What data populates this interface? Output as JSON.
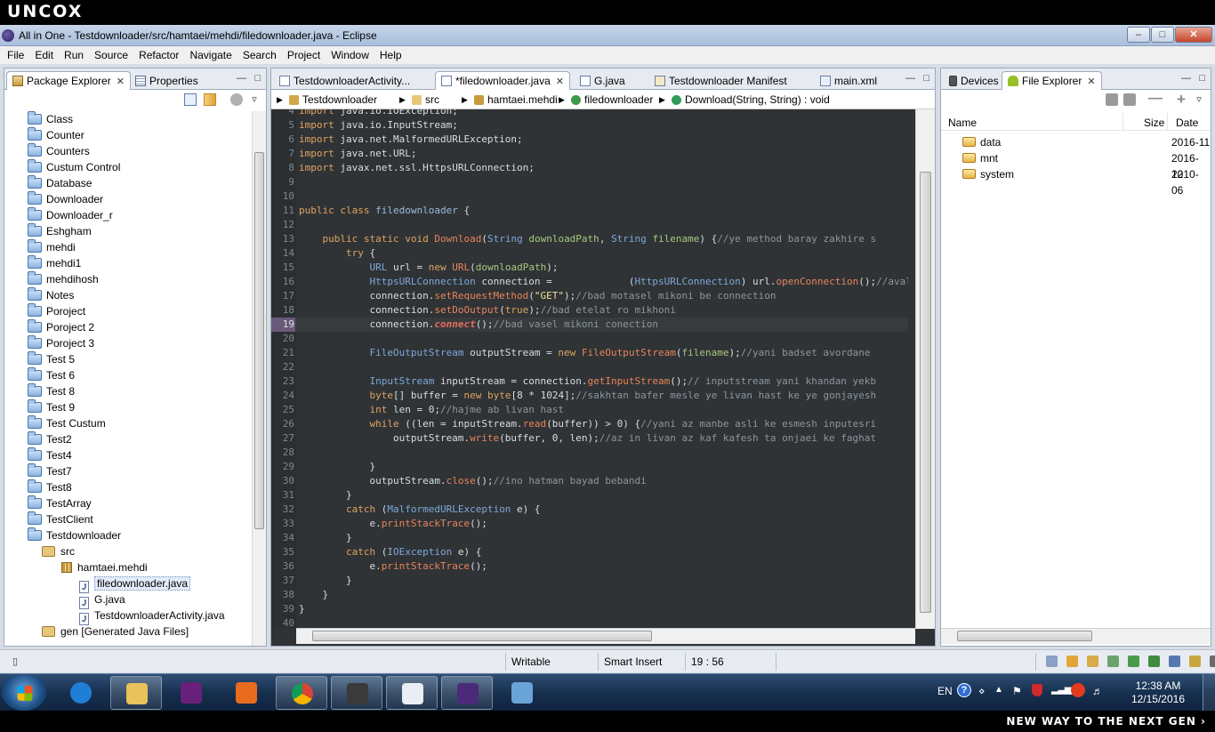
{
  "brand": "uncox",
  "slogan": "NEW WAY TO THE NEXT GEN ›",
  "window": {
    "title": "All in One - Testdownloader/src/hamtaei/mehdi/filedownloader.java - Eclipse",
    "minimize": "–",
    "maximize": "□",
    "close": "✕"
  },
  "menu": [
    "File",
    "Edit",
    "Run",
    "Source",
    "Refactor",
    "Navigate",
    "Search",
    "Project",
    "Window",
    "Help"
  ],
  "left_panel": {
    "tabs": [
      {
        "label": "Package Explorer",
        "close": "✕",
        "icon": "package-explorer-icon"
      },
      {
        "label": "Properties",
        "icon": "properties-icon"
      }
    ],
    "tree": [
      {
        "label": "Class",
        "kind": "project",
        "level": 0
      },
      {
        "label": "Counter",
        "kind": "project",
        "level": 0
      },
      {
        "label": "Counters",
        "kind": "project",
        "level": 0
      },
      {
        "label": "Custum Control",
        "kind": "project",
        "level": 0
      },
      {
        "label": "Database",
        "kind": "project",
        "level": 0
      },
      {
        "label": "Downloader",
        "kind": "project",
        "level": 0
      },
      {
        "label": "Downloader_r",
        "kind": "project",
        "level": 0
      },
      {
        "label": "Eshgham",
        "kind": "project",
        "level": 0
      },
      {
        "label": "mehdi",
        "kind": "project",
        "level": 0
      },
      {
        "label": "mehdi1",
        "kind": "project",
        "level": 0
      },
      {
        "label": "mehdihosh",
        "kind": "project",
        "level": 0
      },
      {
        "label": "Notes",
        "kind": "project",
        "level": 0
      },
      {
        "label": "Poroject",
        "kind": "project",
        "level": 0
      },
      {
        "label": "Poroject 2",
        "kind": "project",
        "level": 0
      },
      {
        "label": "Poroject 3",
        "kind": "project",
        "level": 0
      },
      {
        "label": "Test 5",
        "kind": "project",
        "level": 0
      },
      {
        "label": "Test 6",
        "kind": "project",
        "level": 0
      },
      {
        "label": "Test 8",
        "kind": "project",
        "level": 0
      },
      {
        "label": "Test 9",
        "kind": "project",
        "level": 0
      },
      {
        "label": "Test Custum",
        "kind": "project",
        "level": 0
      },
      {
        "label": "Test2",
        "kind": "project",
        "level": 0
      },
      {
        "label": "Test4",
        "kind": "project",
        "level": 0
      },
      {
        "label": "Test7",
        "kind": "project",
        "level": 0
      },
      {
        "label": "Test8",
        "kind": "project",
        "level": 0
      },
      {
        "label": "TestArray",
        "kind": "project",
        "level": 0
      },
      {
        "label": "TestClient",
        "kind": "project",
        "level": 0
      },
      {
        "label": "Testdownloader",
        "kind": "project",
        "level": 0
      },
      {
        "label": "src",
        "kind": "srcfolder",
        "level": 1
      },
      {
        "label": "hamtaei.mehdi",
        "kind": "package",
        "level": 2
      },
      {
        "label": "filedownloader.java",
        "kind": "java",
        "level": 3,
        "selected": true
      },
      {
        "label": "G.java",
        "kind": "java",
        "level": 3
      },
      {
        "label": "TestdownloaderActivity.java",
        "kind": "java",
        "level": 3
      },
      {
        "label": "gen [Generated Java Files]",
        "kind": "srcfolder",
        "level": 1
      }
    ]
  },
  "editor": {
    "tabs": [
      {
        "label": "TestdownloaderActivity...",
        "icon": "java-file-icon"
      },
      {
        "label": "*filedownloader.java",
        "icon": "java-file-icon",
        "close": "✕",
        "active": true
      },
      {
        "label": "G.java",
        "icon": "java-file-icon"
      },
      {
        "label": "Testdownloader Manifest",
        "icon": "manifest-icon"
      },
      {
        "label": "main.xml",
        "icon": "xml-file-icon"
      }
    ],
    "breadcrumb": [
      "Testdownloader",
      "src",
      "hamtaei.mehdi",
      "filedownloader",
      "Download(String, String) : void"
    ],
    "lines": [
      {
        "n": "4",
        "html": "<span class='kw'>import</span> java.io.IOException;"
      },
      {
        "n": "5",
        "html": "<span class='kw'>import</span> java.io.InputStream;"
      },
      {
        "n": "6",
        "html": "<span class='kw'>import</span> java.net.MalformedURLException;"
      },
      {
        "n": "7",
        "html": "<span class='kw'>import</span> java.net.URL;"
      },
      {
        "n": "8",
        "html": "<span class='kw'>import</span> javax.net.ssl.HttpsURLConnection;"
      },
      {
        "n": "9",
        "html": ""
      },
      {
        "n": "10",
        "html": ""
      },
      {
        "n": "11",
        "html": "<span class='kw'>public class</span> <span class='fn'>filedownloader</span> {"
      },
      {
        "n": "12",
        "html": ""
      },
      {
        "n": "13",
        "html": "    <span class='kw'>public static void</span> <span class='mt'>Download</span>(<span class='ty'>String</span> <span class='pa'>downloadPath</span>, <span class='ty'>String</span> <span class='pa'>filename</span>) {<span class='cm'>//ye method baray zakhire s</span>"
      },
      {
        "n": "14",
        "html": "        <span class='kw'>try</span> {"
      },
      {
        "n": "15",
        "html": "            <span class='ty'>URL</span> url = <span class='kw'>new</span> <span class='mt'>URL</span>(<span class='pa'>downloadPath</span>);"
      },
      {
        "n": "16",
        "html": "            (<span class='ty'>HttpsURLConnection</span>) url.<span class='mt'>openConnection</span>();<span class='cm'>//aval ye co</span>",
        "prefix": "            <span class='ty'>HttpsURLConnection</span> connection = "
      },
      {
        "n": "17",
        "html": "            connection.<span class='mt'>setRequestMethod</span>(<span class='st'>\"GET\"</span>);<span class='cm'>//bad motasel mikoni be connection</span>"
      },
      {
        "n": "18",
        "html": "            connection.<span class='mt'>setDoOutput</span>(<span class='kw'>true</span>);<span class='cm'>//bad etelat ro mikhoni</span>"
      },
      {
        "n": "19",
        "html": "            connection.<span class='em'>connect</span>();<span class='cm'>//bad vasel mikoni conection</span>"
      },
      {
        "n": "20",
        "html": ""
      },
      {
        "n": "21",
        "html": "            <span class='ty'>FileOutputStream</span> outputStream = <span class='kw'>new</span> <span class='mt'>FileOutputStream</span>(<span class='pa'>filename</span>);<span class='cm'>//yani badset avordane</span>"
      },
      {
        "n": "22",
        "html": ""
      },
      {
        "n": "23",
        "html": "            <span class='ty'>InputStream</span> inputStream = connection.<span class='mt'>getInputStream</span>();<span class='cm'>// inputstream yani khandan yekb</span>"
      },
      {
        "n": "24",
        "html": "            <span class='kw'>byte</span>[] buffer = <span class='kw'>new</span> <span class='kw'>byte</span>[8 * 1024];<span class='cm'>//sakhtan bafer mesle ye livan hast ke ye gonjayesh</span>"
      },
      {
        "n": "25",
        "html": "            <span class='kw'>int</span> len = 0;<span class='cm'>//hajme ab livan hast</span>"
      },
      {
        "n": "26",
        "html": "            <span class='kw'>while</span> ((len = inputStream.<span class='mt'>read</span>(buffer)) &gt; 0) {<span class='cm'>//yani az manbe asli ke esmesh inputesri</span>"
      },
      {
        "n": "27",
        "html": "                outputStream.<span class='mt'>write</span>(buffer, 0, len);<span class='cm'>//az in livan az kaf kafesh ta onjaei ke faghat</span>"
      },
      {
        "n": "28",
        "html": ""
      },
      {
        "n": "29",
        "html": "            }"
      },
      {
        "n": "30",
        "html": "            outputStream.<span class='mt'>close</span>();<span class='cm'>//ino hatman bayad bebandi</span>"
      },
      {
        "n": "31",
        "html": "        }"
      },
      {
        "n": "32",
        "html": "        <span class='kw'>catch</span> (<span class='ty'>MalformedURLException</span> e) {"
      },
      {
        "n": "33",
        "html": "            e.<span class='mt'>printStackTrace</span>();"
      },
      {
        "n": "34",
        "html": "        }"
      },
      {
        "n": "35",
        "html": "        <span class='kw'>catch</span> (<span class='ty'>IOException</span> e) {"
      },
      {
        "n": "36",
        "html": "            e.<span class='mt'>printStackTrace</span>();"
      },
      {
        "n": "37",
        "html": "        }"
      },
      {
        "n": "38",
        "html": "    }"
      },
      {
        "n": "39",
        "html": "}"
      },
      {
        "n": "40",
        "html": ""
      }
    ]
  },
  "right_panel": {
    "tabs": [
      {
        "label": "Devices",
        "icon": "devices-icon"
      },
      {
        "label": "File Explorer",
        "icon": "android-icon",
        "close": "✕",
        "active": true
      }
    ],
    "columns": {
      "name": "Name",
      "size": "Size",
      "date": "Date"
    },
    "rows": [
      {
        "name": "data",
        "date": "2016-11"
      },
      {
        "name": "mnt",
        "date": "2016-12"
      },
      {
        "name": "system",
        "date": "2010-06"
      }
    ]
  },
  "status": {
    "writable": "Writable",
    "insert_mode": "Smart Insert",
    "position": "19 : 56"
  },
  "taskbar": {
    "apps": [
      {
        "name": "internet-explorer-taskbar-icon",
        "color": "#1f7fd6",
        "open": false
      },
      {
        "name": "file-explorer-taskbar-icon",
        "color": "#e8c25a",
        "open": true
      },
      {
        "name": "visual-studio-taskbar-icon",
        "color": "#68217a",
        "open": false
      },
      {
        "name": "media-player-taskbar-icon",
        "color": "#e86b1e",
        "open": false
      },
      {
        "name": "chrome-taskbar-icon",
        "color": "#3aa655",
        "open": true
      },
      {
        "name": "video-editor-taskbar-icon",
        "color": "#3a3a3a",
        "open": true
      },
      {
        "name": "notepad-taskbar-icon",
        "color": "#e9eef5",
        "open": true
      },
      {
        "name": "java-ee-ide-taskbar-icon",
        "color": "#4b2a7a",
        "open": true
      },
      {
        "name": "paint-taskbar-icon",
        "color": "#6aa3d8",
        "open": false
      }
    ],
    "language": "EN",
    "time": "12:38 AM",
    "date": "12/15/2016"
  }
}
